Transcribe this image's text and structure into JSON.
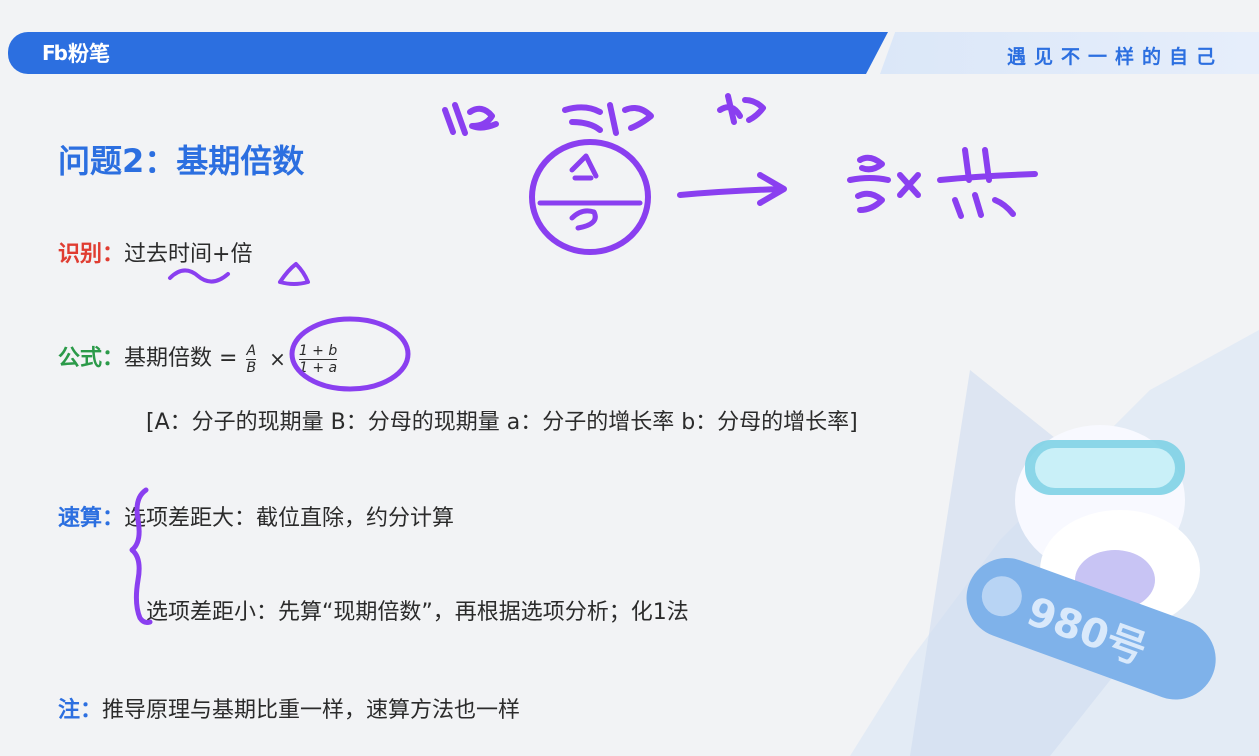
{
  "header": {
    "logo_mark": "Fb",
    "logo_text": "粉笔",
    "slogan": "遇见不一样的自己"
  },
  "title": "问题2：基期倍数",
  "identify": {
    "label": "识别：",
    "text": "过去时间+倍"
  },
  "formula": {
    "label": "公式：",
    "lhs": "基期倍数 =",
    "frac1_num": "A",
    "frac1_den": "B",
    "times": "×",
    "frac2_num": "1 + b",
    "frac2_den": "1 + a",
    "legend": "[A：分子的现期量   B：分母的现期量   a：分子的增长率   b：分母的增长率]"
  },
  "quick": {
    "label": "速算：",
    "line1": "选项差距大：截位直除，约分计算",
    "line2": "选项差距小：先算“现期倍数”，再根据选项分析；化1法"
  },
  "note": {
    "label": "注：",
    "text": "推导原理与基期比重一样，速算方法也一样"
  },
  "mascot": {
    "badge": "980号"
  },
  "colors": {
    "brand": "#2c6fe0",
    "ink_annotation": "#8a3ff0",
    "identify": "#e03c31",
    "formula": "#2b9a49"
  }
}
